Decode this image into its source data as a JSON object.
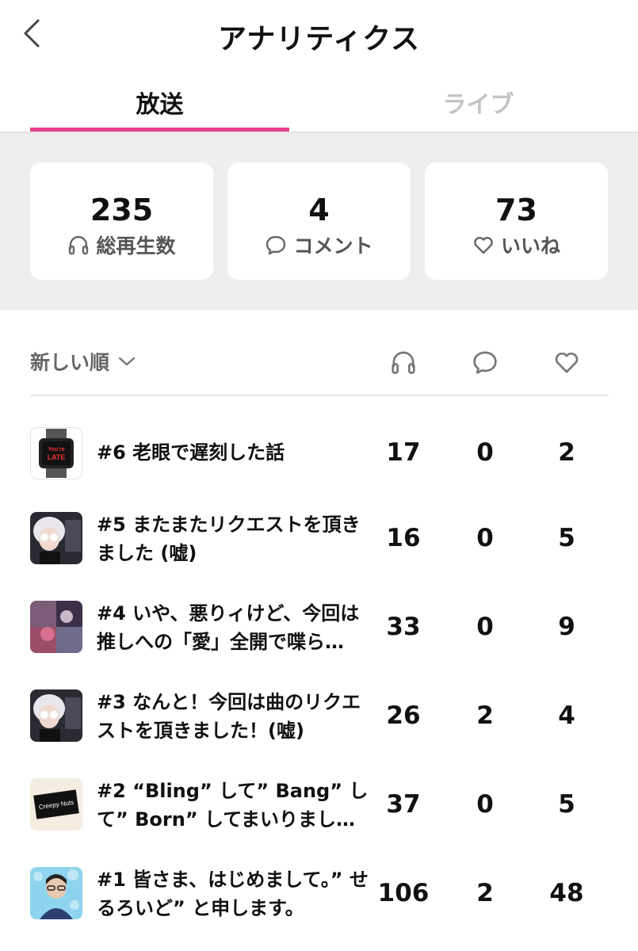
{
  "header": {
    "title": "アナリティクス"
  },
  "tabs": [
    {
      "label": "放送"
    },
    {
      "label": "ライブ"
    }
  ],
  "stats": {
    "plays": {
      "value": "235",
      "label": "総再生数"
    },
    "comments": {
      "value": "4",
      "label": "コメント"
    },
    "likes": {
      "value": "73",
      "label": "いいね"
    }
  },
  "list": {
    "sort_label": "新しい順",
    "episodes": [
      {
        "title": "#6 老眼で遅刻した話",
        "plays": "17",
        "comments": "0",
        "likes": "2"
      },
      {
        "title": "#5 またまたリクエストを頂きました (嘘)",
        "plays": "16",
        "comments": "0",
        "likes": "5"
      },
      {
        "title": "#4 いや、悪りィけど、今回は推しへの「愛」全開で喋ら…",
        "plays": "33",
        "comments": "0",
        "likes": "9"
      },
      {
        "title": "#3 なんと！今回は曲のリクエストを頂きました！(嘘)",
        "plays": "26",
        "comments": "2",
        "likes": "4"
      },
      {
        "title": "#2 “Bling” して” Bang” して” Born” してまいりまし…",
        "plays": "37",
        "comments": "0",
        "likes": "5"
      },
      {
        "title": "#1 皆さま、はじめまして。” せるろいど” と申します。",
        "plays": "106",
        "comments": "2",
        "likes": "48"
      }
    ],
    "thumb_texts": {
      "watch": "You're LATE",
      "creepy": "Creepy Nuts"
    }
  },
  "colors": {
    "accent": "#e8408a",
    "band": "#eeeeee"
  },
  "icons": [
    "back-chevron-icon",
    "headphones-icon",
    "comment-bubble-icon",
    "heart-icon",
    "chevron-down-icon"
  ]
}
